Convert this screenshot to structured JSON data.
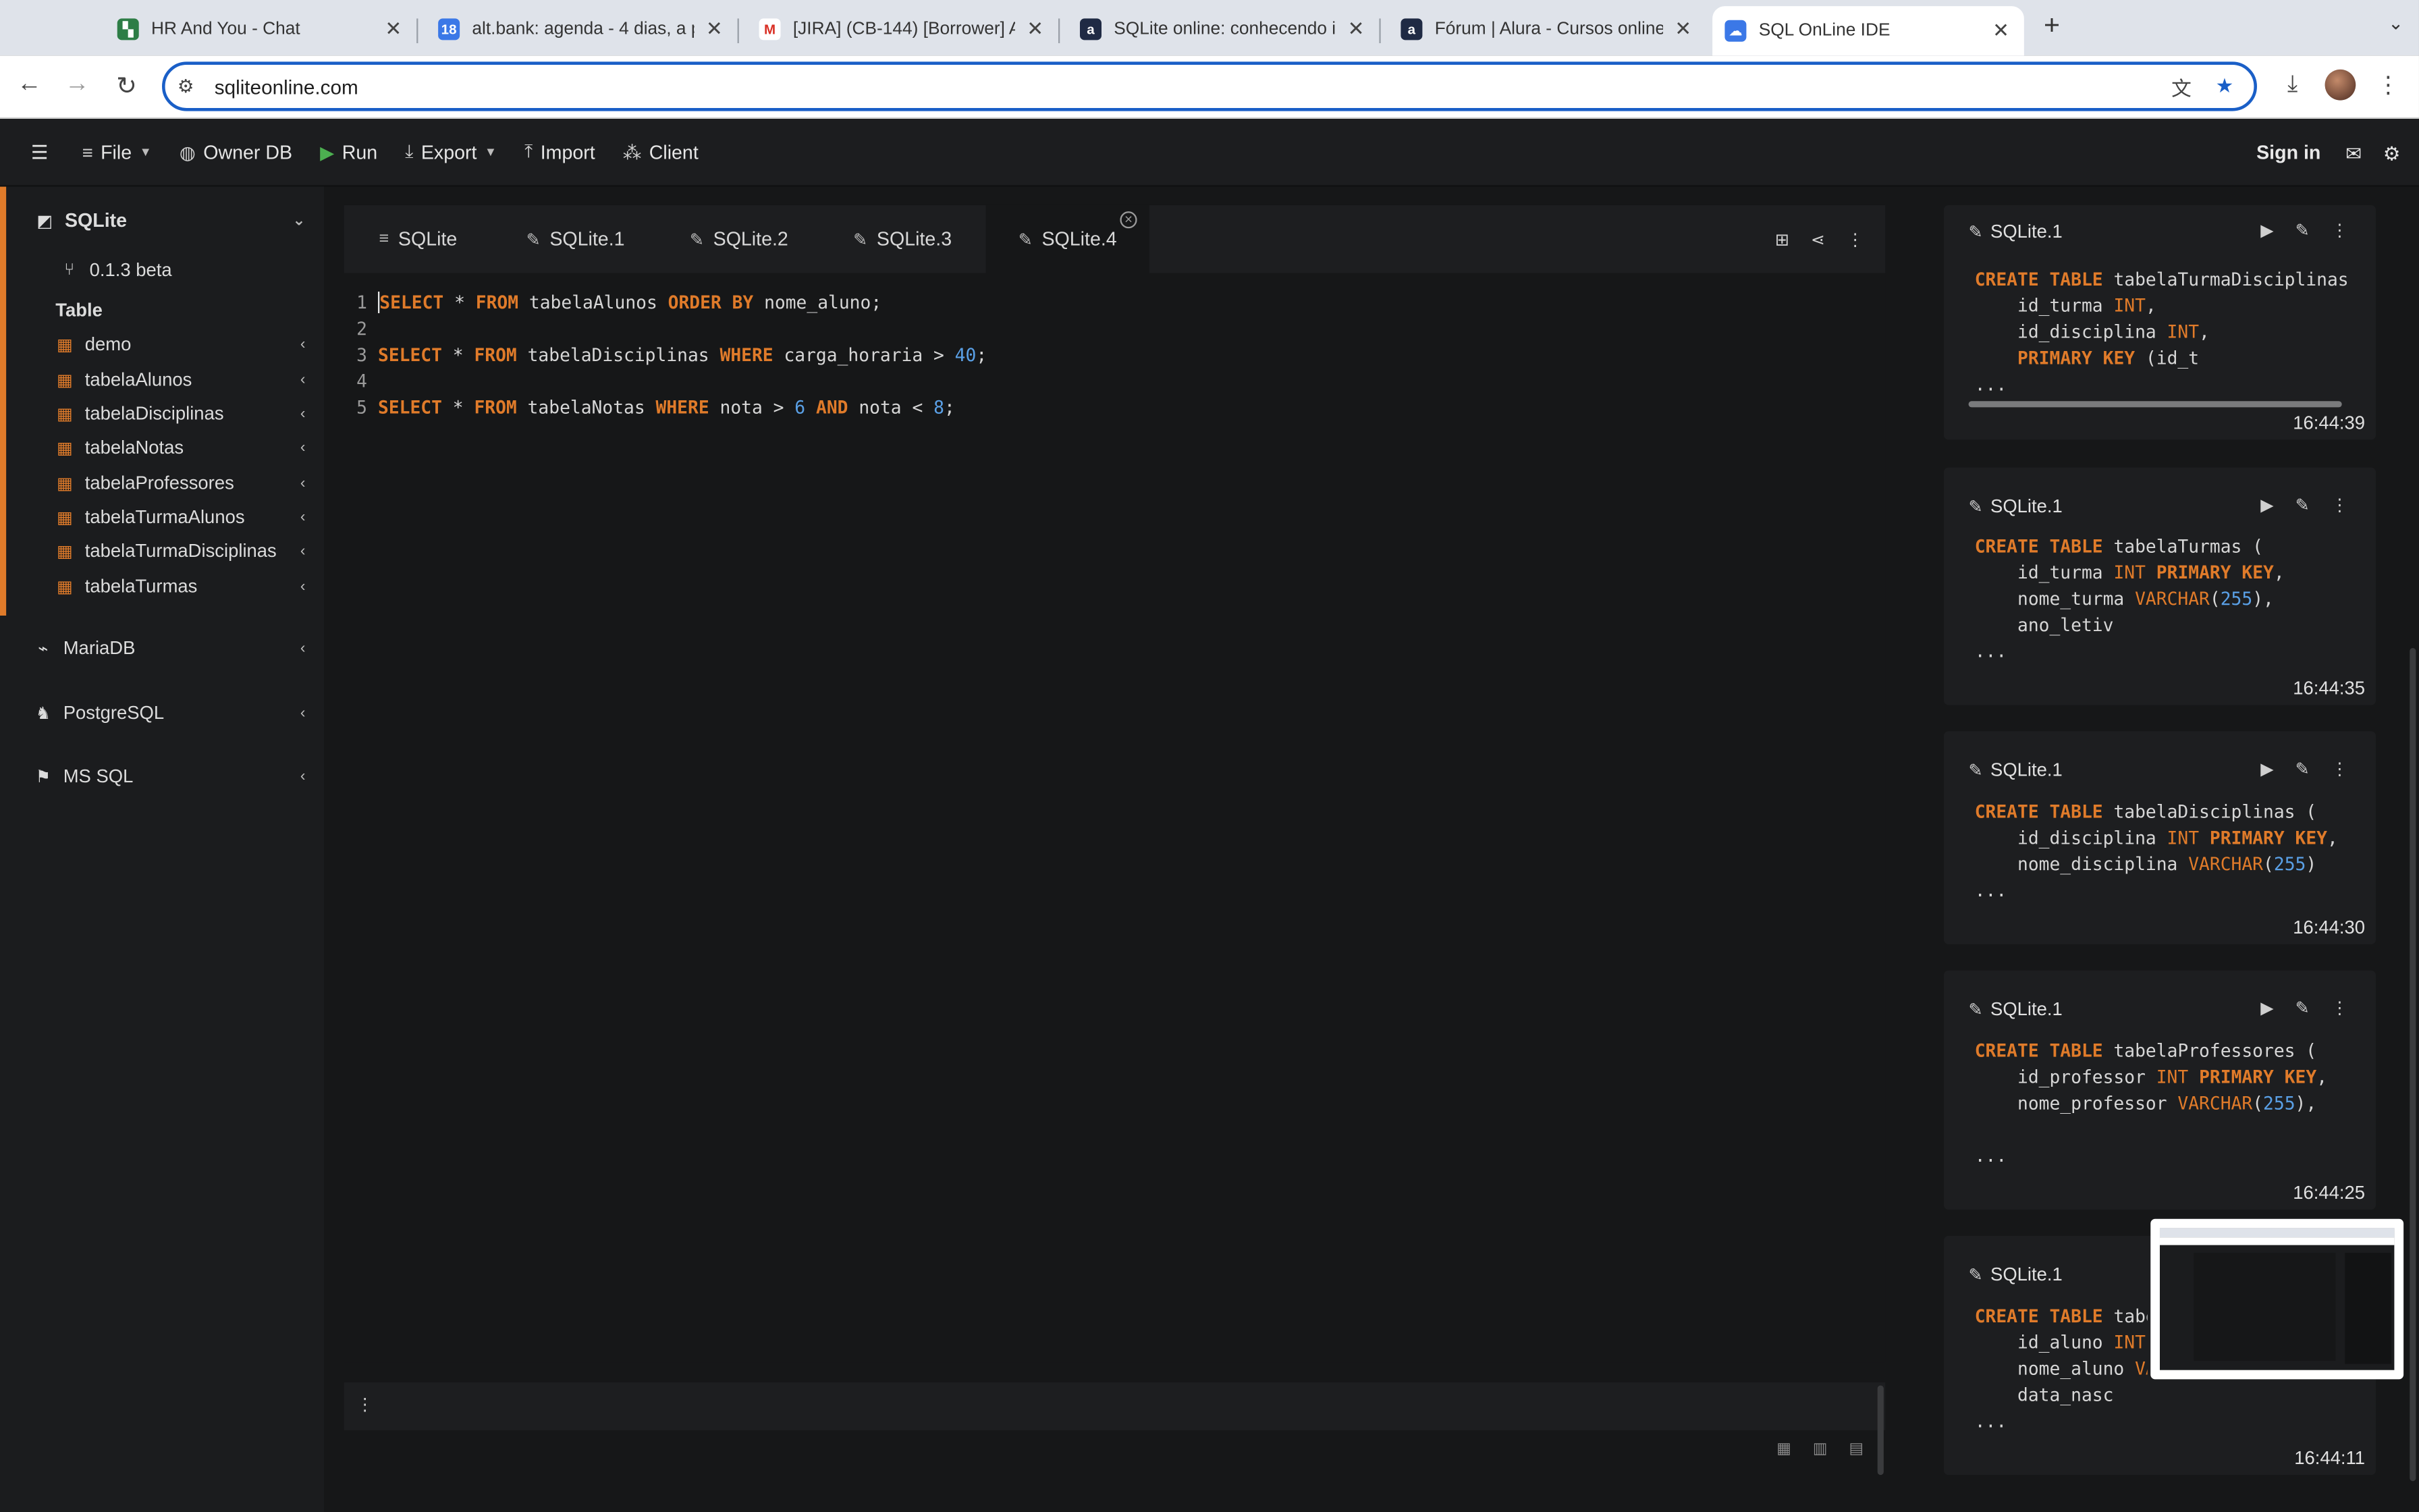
{
  "browser": {
    "tabs": [
      {
        "title": "HR And You - Chat",
        "favicon_color": "#2d7d46"
      },
      {
        "title": "alt.bank: agenda - 4 dias, a p",
        "favicon_color": "#3b78e7"
      },
      {
        "title": "[JIRA] (CB-144) [Borrower] A",
        "favicon_color": "#d93025"
      },
      {
        "title": "SQLite online: conhecendo in",
        "favicon_color": "#1f2a44"
      },
      {
        "title": "Fórum | Alura - Cursos online",
        "favicon_color": "#1f2a44"
      },
      {
        "title": "SQL OnLine IDE",
        "favicon_color": "#3b78e7"
      }
    ],
    "url": "sqliteonline.com",
    "accent": "#1a5fc7"
  },
  "header": {
    "file": "File",
    "owner_db": "Owner DB",
    "run": "Run",
    "export": "Export",
    "import": "Import",
    "client": "Client",
    "sign_in": "Sign in"
  },
  "sidebar": {
    "sqlite": "SQLite",
    "version": "0.1.3 beta",
    "table_heading": "Table",
    "tables": [
      "demo",
      "tabelaAlunos",
      "tabelaDisciplinas",
      "tabelaNotas",
      "tabelaProfessores",
      "tabelaTurmaAlunos",
      "tabelaTurmaDisciplinas",
      "tabelaTurmas"
    ],
    "engines": [
      "MariaDB",
      "PostgreSQL",
      "MS SQL"
    ],
    "accent": "#e07b2a"
  },
  "editor": {
    "tabs": [
      "SQLite",
      "SQLite.1",
      "SQLite.2",
      "SQLite.3",
      "SQLite.4"
    ],
    "line_numbers": [
      "1",
      "2",
      "3",
      "4",
      "5"
    ]
  },
  "history": [
    {
      "name": "SQLite.1",
      "time": "16:44:39",
      "more": "..."
    },
    {
      "name": "SQLite.1",
      "time": "16:44:35",
      "more": "..."
    },
    {
      "name": "SQLite.1",
      "time": "16:44:30",
      "more": "..."
    },
    {
      "name": "SQLite.1",
      "time": "16:44:25",
      "more": "..."
    },
    {
      "name": "SQLite.1",
      "time": "16:44:11",
      "more": "..."
    }
  ]
}
